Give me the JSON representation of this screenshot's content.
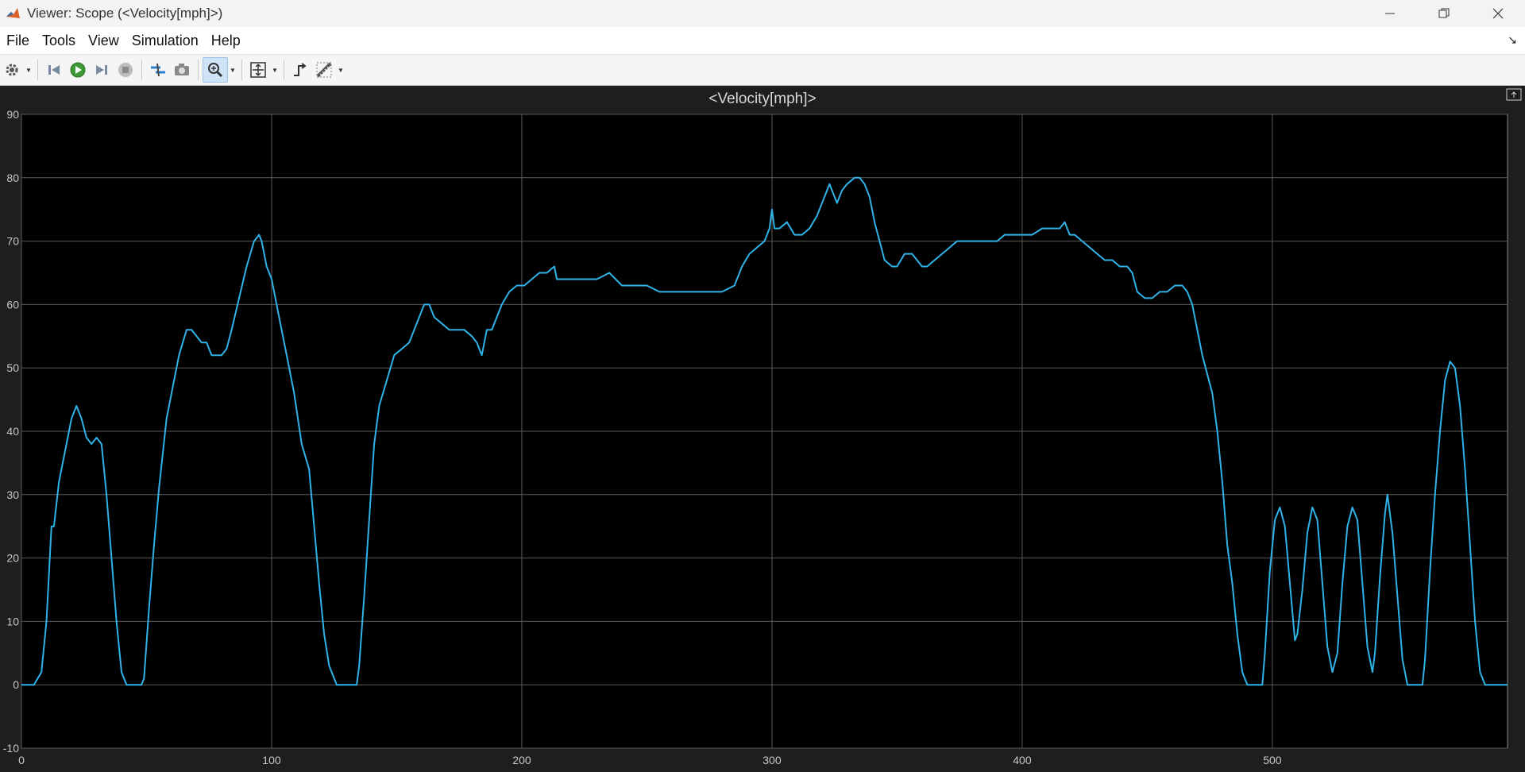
{
  "window": {
    "title": "Viewer: Scope (<Velocity[mph]>)",
    "controls": [
      "minimize",
      "restore",
      "close"
    ]
  },
  "menu": {
    "items": [
      "File",
      "Tools",
      "View",
      "Simulation",
      "Help"
    ]
  },
  "toolbar": {
    "icons": [
      "settings-icon",
      "step-back-icon",
      "run-icon",
      "step-forward-icon",
      "stop-icon",
      "highlight-signal-icon",
      "snapshot-icon",
      "zoom-in-icon",
      "autoscale-icon",
      "triggers-icon",
      "measurements-icon"
    ]
  },
  "colors": {
    "plot_bg": "#000000",
    "frame_bg": "#1e1e1e",
    "line": "#2fb3e8",
    "grid": "#5a5a5a",
    "tick_text": "#c8c8c8"
  },
  "chart_data": {
    "type": "line",
    "title": "<Velocity[mph]>",
    "xlabel": "",
    "ylabel": "",
    "xlim": [
      0,
      594
    ],
    "ylim": [
      -10,
      90
    ],
    "xticks": [
      0,
      100,
      200,
      300,
      400,
      500
    ],
    "yticks": [
      -10,
      0,
      10,
      20,
      30,
      40,
      50,
      60,
      70,
      80,
      90
    ],
    "grid": true,
    "series": [
      {
        "name": "",
        "points": [
          [
            0,
            0
          ],
          [
            5,
            0
          ],
          [
            8,
            2
          ],
          [
            10,
            10
          ],
          [
            12,
            25
          ],
          [
            13,
            25
          ],
          [
            15,
            32
          ],
          [
            18,
            38
          ],
          [
            20,
            42
          ],
          [
            22,
            44
          ],
          [
            24,
            42
          ],
          [
            26,
            39
          ],
          [
            28,
            38
          ],
          [
            30,
            39
          ],
          [
            32,
            38
          ],
          [
            34,
            30
          ],
          [
            36,
            20
          ],
          [
            38,
            10
          ],
          [
            40,
            2
          ],
          [
            42,
            0
          ],
          [
            48,
            0
          ],
          [
            49,
            1
          ],
          [
            51,
            12
          ],
          [
            53,
            22
          ],
          [
            55,
            31
          ],
          [
            58,
            42
          ],
          [
            61,
            48
          ],
          [
            63,
            52
          ],
          [
            66,
            56
          ],
          [
            68,
            56
          ],
          [
            70,
            55
          ],
          [
            72,
            54
          ],
          [
            74,
            54
          ],
          [
            76,
            52
          ],
          [
            78,
            52
          ],
          [
            80,
            52
          ],
          [
            82,
            53
          ],
          [
            84,
            56
          ],
          [
            87,
            61
          ],
          [
            90,
            66
          ],
          [
            93,
            70
          ],
          [
            95,
            71
          ],
          [
            96,
            70
          ],
          [
            98,
            66
          ],
          [
            100,
            64
          ],
          [
            103,
            58
          ],
          [
            106,
            52
          ],
          [
            109,
            46
          ],
          [
            112,
            38
          ],
          [
            115,
            34
          ],
          [
            117,
            25
          ],
          [
            119,
            16
          ],
          [
            121,
            8
          ],
          [
            123,
            3
          ],
          [
            126,
            0
          ],
          [
            134,
            0
          ],
          [
            135,
            3
          ],
          [
            137,
            14
          ],
          [
            139,
            26
          ],
          [
            141,
            38
          ],
          [
            143,
            44
          ],
          [
            146,
            48
          ],
          [
            149,
            52
          ],
          [
            152,
            53
          ],
          [
            155,
            54
          ],
          [
            157,
            56
          ],
          [
            159,
            58
          ],
          [
            161,
            60
          ],
          [
            163,
            60
          ],
          [
            165,
            58
          ],
          [
            168,
            57
          ],
          [
            171,
            56
          ],
          [
            174,
            56
          ],
          [
            177,
            56
          ],
          [
            180,
            55
          ],
          [
            182,
            54
          ],
          [
            184,
            52
          ],
          [
            186,
            56
          ],
          [
            188,
            56
          ],
          [
            190,
            58
          ],
          [
            192,
            60
          ],
          [
            195,
            62
          ],
          [
            198,
            63
          ],
          [
            201,
            63
          ],
          [
            204,
            64
          ],
          [
            207,
            65
          ],
          [
            210,
            65
          ],
          [
            213,
            66
          ],
          [
            214,
            64
          ],
          [
            217,
            64
          ],
          [
            220,
            64
          ],
          [
            225,
            64
          ],
          [
            230,
            64
          ],
          [
            235,
            65
          ],
          [
            240,
            63
          ],
          [
            245,
            63
          ],
          [
            250,
            63
          ],
          [
            255,
            62
          ],
          [
            260,
            62
          ],
          [
            265,
            62
          ],
          [
            270,
            62
          ],
          [
            275,
            62
          ],
          [
            280,
            62
          ],
          [
            285,
            63
          ],
          [
            288,
            66
          ],
          [
            291,
            68
          ],
          [
            294,
            69
          ],
          [
            297,
            70
          ],
          [
            299,
            72
          ],
          [
            300,
            75
          ],
          [
            301,
            72
          ],
          [
            303,
            72
          ],
          [
            306,
            73
          ],
          [
            309,
            71
          ],
          [
            312,
            71
          ],
          [
            315,
            72
          ],
          [
            318,
            74
          ],
          [
            321,
            77
          ],
          [
            323,
            79
          ],
          [
            325,
            77
          ],
          [
            326,
            76
          ],
          [
            328,
            78
          ],
          [
            330,
            79
          ],
          [
            333,
            80
          ],
          [
            335,
            80
          ],
          [
            337,
            79
          ],
          [
            339,
            77
          ],
          [
            341,
            73
          ],
          [
            343,
            70
          ],
          [
            345,
            67
          ],
          [
            348,
            66
          ],
          [
            350,
            66
          ],
          [
            353,
            68
          ],
          [
            356,
            68
          ],
          [
            358,
            67
          ],
          [
            360,
            66
          ],
          [
            362,
            66
          ],
          [
            365,
            67
          ],
          [
            368,
            68
          ],
          [
            371,
            69
          ],
          [
            374,
            70
          ],
          [
            377,
            70
          ],
          [
            380,
            70
          ],
          [
            383,
            70
          ],
          [
            386,
            70
          ],
          [
            390,
            70
          ],
          [
            393,
            71
          ],
          [
            396,
            71
          ],
          [
            400,
            71
          ],
          [
            404,
            71
          ],
          [
            408,
            72
          ],
          [
            412,
            72
          ],
          [
            415,
            72
          ],
          [
            417,
            73
          ],
          [
            419,
            71
          ],
          [
            421,
            71
          ],
          [
            424,
            70
          ],
          [
            427,
            69
          ],
          [
            430,
            68
          ],
          [
            433,
            67
          ],
          [
            436,
            67
          ],
          [
            439,
            66
          ],
          [
            442,
            66
          ],
          [
            444,
            65
          ],
          [
            446,
            62
          ],
          [
            449,
            61
          ],
          [
            452,
            61
          ],
          [
            455,
            62
          ],
          [
            458,
            62
          ],
          [
            461,
            63
          ],
          [
            464,
            63
          ],
          [
            466,
            62
          ],
          [
            468,
            60
          ],
          [
            470,
            56
          ],
          [
            472,
            52
          ],
          [
            474,
            49
          ],
          [
            476,
            46
          ],
          [
            478,
            40
          ],
          [
            480,
            32
          ],
          [
            482,
            22
          ],
          [
            484,
            16
          ],
          [
            486,
            8
          ],
          [
            488,
            2
          ],
          [
            490,
            0
          ],
          [
            496,
            0
          ],
          [
            497,
            5
          ],
          [
            499,
            18
          ],
          [
            501,
            26
          ],
          [
            503,
            28
          ],
          [
            505,
            25
          ],
          [
            507,
            16
          ],
          [
            509,
            7
          ],
          [
            510,
            8
          ],
          [
            512,
            15
          ],
          [
            514,
            24
          ],
          [
            516,
            28
          ],
          [
            518,
            26
          ],
          [
            520,
            16
          ],
          [
            522,
            6
          ],
          [
            524,
            2
          ],
          [
            526,
            5
          ],
          [
            528,
            16
          ],
          [
            530,
            25
          ],
          [
            532,
            28
          ],
          [
            534,
            26
          ],
          [
            536,
            16
          ],
          [
            538,
            6
          ],
          [
            540,
            2
          ],
          [
            541,
            5
          ],
          [
            543,
            17
          ],
          [
            545,
            27
          ],
          [
            546,
            30
          ],
          [
            548,
            24
          ],
          [
            550,
            14
          ],
          [
            552,
            4
          ],
          [
            554,
            0
          ],
          [
            560,
            0
          ],
          [
            561,
            4
          ],
          [
            563,
            18
          ],
          [
            565,
            30
          ],
          [
            567,
            40
          ],
          [
            569,
            48
          ],
          [
            571,
            51
          ],
          [
            573,
            50
          ],
          [
            575,
            44
          ],
          [
            577,
            34
          ],
          [
            579,
            22
          ],
          [
            581,
            10
          ],
          [
            583,
            2
          ],
          [
            585,
            0
          ],
          [
            594,
            0
          ]
        ]
      }
    ]
  }
}
